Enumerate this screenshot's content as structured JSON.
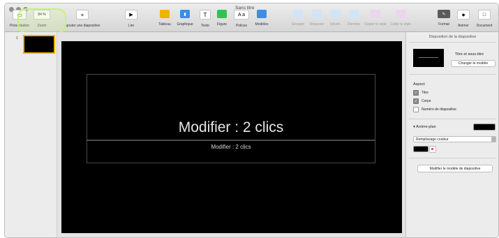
{
  "window": {
    "title": "Sans titre"
  },
  "toolbar": {
    "presentation": "Présentation",
    "zoom_value": "84 %",
    "zoom": "Zoom",
    "add_slide": "Ajouter une diapositive",
    "play": "Lire",
    "table": "Tableau",
    "chart": "Graphique",
    "text": "Texte",
    "shape": "Figure",
    "fonts": "Polices",
    "fonts_icon_text": "A a",
    "media": "Modèles",
    "group": "Grouper",
    "ungroup": "Dissocier",
    "unlock": "Dévérr.",
    "back": "Derrière",
    "copy_style": "Copier le style",
    "paste_style": "Coller le style",
    "format": "Format",
    "animate": "Animer",
    "document": "Document"
  },
  "navigator": {
    "slide_number": "1"
  },
  "slide": {
    "title": "Modifier : 2 clics",
    "body": "Modifier : 2 clics"
  },
  "inspector": {
    "header": "Disposition de la diapositive",
    "master_name": "Titre et sous-titre",
    "change_master": "Changer le modèle",
    "appearance": "Aspect",
    "opt_title": "Titre",
    "opt_body": "Corps",
    "opt_slide_number": "Numéro de diapositive",
    "background": "Arrière-plan",
    "fill": "Remplissage couleur",
    "edit_master": "Modifier le modèle de diapositive"
  },
  "colors": {
    "accent": "#3a8ee6",
    "highlight": "#c7f277",
    "selection": "#f2b200"
  }
}
